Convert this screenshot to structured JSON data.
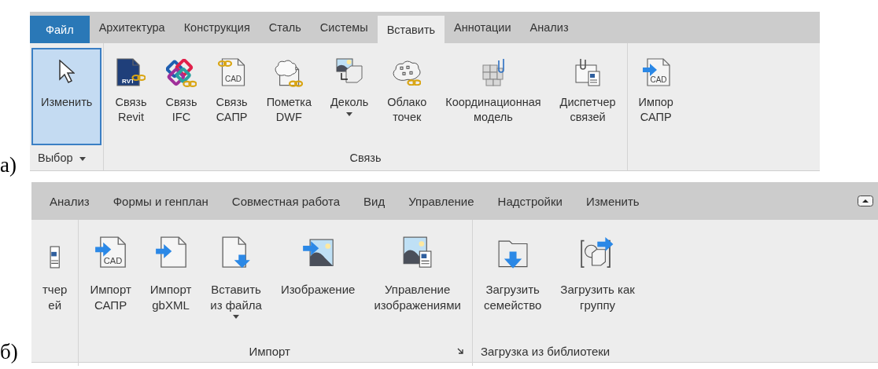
{
  "figures": [
    {
      "label": "а)",
      "ribbon": {
        "tabs": [
          {
            "label": "Файл",
            "kind": "application"
          },
          {
            "label": "Архитектура",
            "kind": "tab",
            "selected": false
          },
          {
            "label": "Конструкция",
            "kind": "tab",
            "selected": false
          },
          {
            "label": "Сталь",
            "kind": "tab",
            "selected": false
          },
          {
            "label": "Системы",
            "kind": "tab",
            "selected": false
          },
          {
            "label": "Вставить",
            "kind": "tab",
            "selected": true
          },
          {
            "label": "Аннотации",
            "kind": "tab",
            "selected": false
          },
          {
            "label": "Анализ",
            "kind": "tab",
            "selected": false
          }
        ],
        "panels": [
          {
            "title": "Выбор",
            "title_dropdown": true,
            "buttons": [
              {
                "label_lines": [
                  "Изменить"
                ],
                "selected": true
              }
            ]
          },
          {
            "title": "Связь",
            "buttons": [
              {
                "label_lines": [
                  "Связь",
                  "Revit"
                ],
                "icon_text": "RVT",
                "selected": false
              },
              {
                "label_lines": [
                  "Связь",
                  "IFC"
                ],
                "selected": false
              },
              {
                "label_lines": [
                  "Связь",
                  "САПР"
                ],
                "icon_text": "CAD",
                "selected": false
              },
              {
                "label_lines": [
                  "Пометка",
                  "DWF"
                ],
                "selected": false
              },
              {
                "label_lines": [
                  "Деколь"
                ],
                "dropdown": true,
                "selected": false
              },
              {
                "label_lines": [
                  "Облако",
                  "точек"
                ],
                "selected": false
              },
              {
                "label_lines": [
                  "Координационная",
                  "модель"
                ],
                "selected": false
              },
              {
                "label_lines": [
                  "Диспетчер",
                  "связей"
                ],
                "selected": false
              }
            ]
          },
          {
            "buttons": [
              {
                "label_lines": [
                  "Импор",
                  "САПР"
                ],
                "icon_text": "CAD",
                "selected": false
              }
            ]
          }
        ]
      }
    },
    {
      "label": "б)",
      "ribbon": {
        "collapse_button": true,
        "tabs": [
          {
            "label": "Анализ",
            "kind": "tab",
            "selected": false
          },
          {
            "label": "Формы и генплан",
            "kind": "tab",
            "selected": false
          },
          {
            "label": "Совместная работа",
            "kind": "tab",
            "selected": false
          },
          {
            "label": "Вид",
            "kind": "tab",
            "selected": false
          },
          {
            "label": "Управление",
            "kind": "tab",
            "selected": false
          },
          {
            "label": "Надстройки",
            "kind": "tab",
            "selected": false
          },
          {
            "label": "Изменить",
            "kind": "tab",
            "selected": false
          }
        ],
        "panels": [
          {
            "buttons": [
              {
                "label_lines": [
                  "тчер",
                  "ей"
                ],
                "selected": false
              }
            ]
          },
          {
            "title": "Импорт",
            "launcher": true,
            "buttons": [
              {
                "label_lines": [
                  "Импорт",
                  "САПР"
                ],
                "icon_text": "CAD",
                "selected": false
              },
              {
                "label_lines": [
                  "Импорт",
                  "gbXML"
                ],
                "selected": false
              },
              {
                "label_lines": [
                  "Вставить",
                  "из файла"
                ],
                "dropdown": true,
                "selected": false
              },
              {
                "label_lines": [
                  "Изображение"
                ],
                "selected": false
              },
              {
                "label_lines": [
                  "Управление",
                  "изображениями"
                ],
                "selected": false
              }
            ]
          },
          {
            "title": "Загрузка из библиотеки",
            "buttons": [
              {
                "label_lines": [
                  "Загрузить",
                  "семейство"
                ],
                "selected": false
              },
              {
                "label_lines": [
                  "Загрузить как",
                  "группу"
                ],
                "selected": false
              }
            ]
          }
        ]
      }
    }
  ]
}
